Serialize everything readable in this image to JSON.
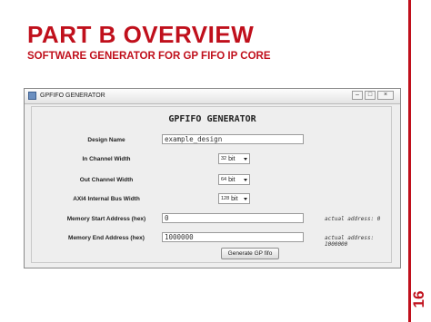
{
  "slide": {
    "title": "PART B OVERVIEW",
    "subtitle": "SOFTWARE GENERATOR FOR GP FIFO IP CORE",
    "page_number": "16"
  },
  "window": {
    "title": "GPFIFO GENERATOR",
    "heading": "GPFIFO GENERATOR",
    "design_name": {
      "label": "Design Name",
      "value": "example_design"
    },
    "in_channel_width": {
      "label": "In Channel Width",
      "value": "32",
      "unit": "bit"
    },
    "out_channel_width": {
      "label": "Out Channel Width",
      "value": "64",
      "unit": "bit"
    },
    "axi_bus_width": {
      "label": "AXI4 Internal Bus Width",
      "value": "128",
      "unit": "bit"
    },
    "mem_start": {
      "label": "Memory Start Address (hex)",
      "value": "0",
      "note": "actual address: 0"
    },
    "mem_end": {
      "label": "Memory End Address (hex)",
      "value": "1000000",
      "note": "actual address: 1000000"
    },
    "generate_label": "Generate GP fifo"
  }
}
